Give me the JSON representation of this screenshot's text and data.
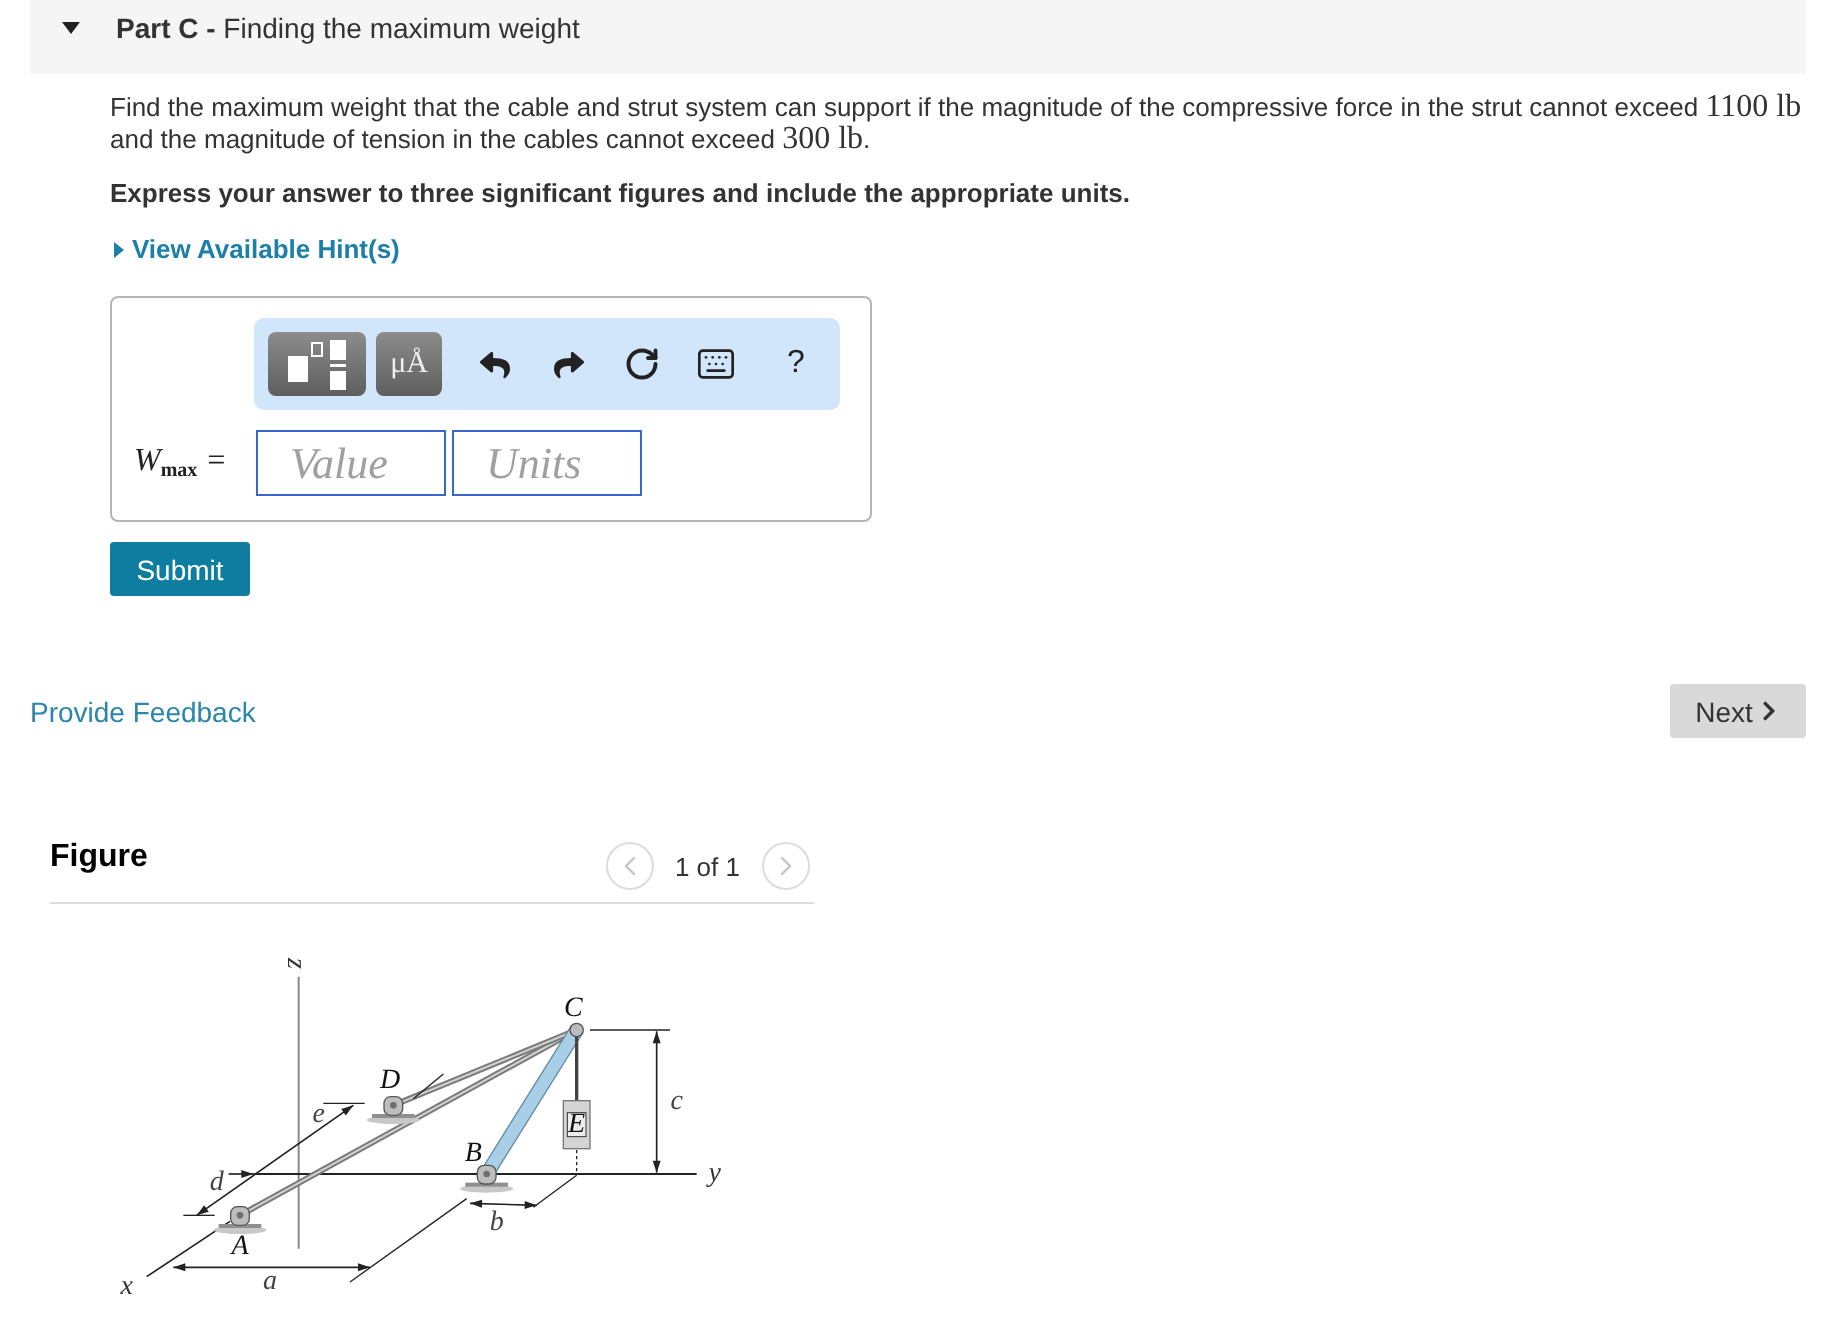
{
  "part": {
    "title": "**Part C -** Finding the maximum weight",
    "expanded": true
  },
  "problem": [
    {
      "kind": "text",
      "text": "Find the maximum weight that the cable and strut system can support if the magnitude of the compressive force in the strut cannot exceed "
    },
    {
      "kind": "math",
      "text": "1100 lb"
    },
    {
      "kind": "text",
      "text": " and the magnitude of tension in the cables cannot exceed "
    },
    {
      "kind": "math",
      "text": "300 lb"
    },
    {
      "kind": "text",
      "text": "."
    }
  ],
  "instruction": "Express your answer to three significant figures and include the appropriate units.",
  "hint": {
    "label": "View Available Hint(s)",
    "expanded": false
  },
  "answer": {
    "toolbar": [
      {
        "kind": "templates"
      },
      {
        "kind": "symbols",
        "label": "μÅ"
      },
      {
        "kind": "undo"
      },
      {
        "kind": "redo"
      },
      {
        "kind": "reset"
      },
      {
        "kind": "keyboard"
      },
      {
        "kind": "help",
        "label": "?"
      }
    ],
    "label": "W$_{max}$ =",
    "value_field": {
      "placeholder": "Value"
    },
    "units_field": {
      "placeholder": "Units"
    }
  },
  "submit_button": "Submit",
  "feedback_link": "Provide Feedback",
  "next_button": "Next",
  "figure": {
    "title": "Figure",
    "pager": {
      "text": "1 of 1",
      "previous_disabled": true,
      "next_disabled": true
    },
    "labels": [
      {
        "kind": "axis",
        "text": "z"
      },
      {
        "kind": "point",
        "text": "C"
      },
      {
        "kind": "point",
        "text": "D"
      },
      {
        "kind": "dimension",
        "text": "c"
      },
      {
        "kind": "dimension",
        "text": "e"
      },
      {
        "kind": "point",
        "text": "E"
      },
      {
        "kind": "point",
        "text": "B"
      },
      {
        "kind": "axis",
        "text": "y"
      },
      {
        "kind": "dimension",
        "text": "d"
      },
      {
        "kind": "dimension",
        "text": "b"
      },
      {
        "kind": "point",
        "text": "A"
      },
      {
        "kind": "axis",
        "text": "x"
      },
      {
        "kind": "dimension",
        "text": "a"
      }
    ]
  }
}
